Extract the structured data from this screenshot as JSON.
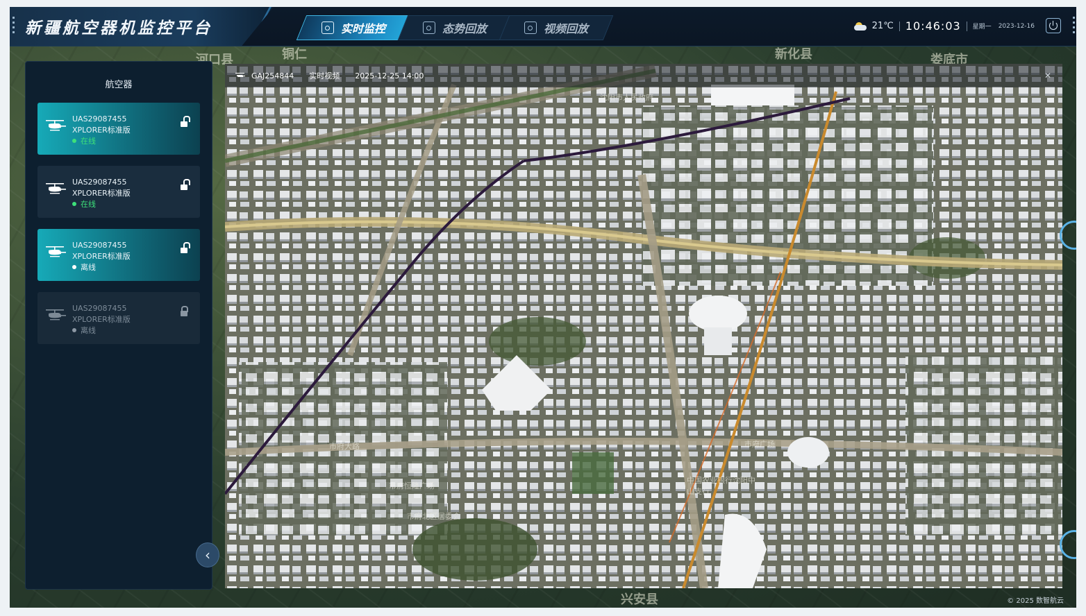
{
  "app": {
    "title": "新疆航空器机监控平台"
  },
  "tabs": [
    {
      "label": "实时监控",
      "active": true
    },
    {
      "label": "态势回放",
      "active": false
    },
    {
      "label": "视频回放",
      "active": false
    }
  ],
  "status": {
    "temperature": "21℃",
    "time": "10:46:03",
    "weekday": "星期一",
    "date": "2023-12-16",
    "weather_icon": "partly-cloudy-icon"
  },
  "panel": {
    "title": "航空器",
    "aircraft": [
      {
        "id": "UAS29087455",
        "model": "XPLORER标准版",
        "status": "在线",
        "status_color": "#3ee07a",
        "state": "online",
        "lock": "unlocked"
      },
      {
        "id": "UAS29087455",
        "model": "XPLORER标准版",
        "status": "在线",
        "status_color": "#3ee07a",
        "state": "normal",
        "lock": "unlocked"
      },
      {
        "id": "UAS29087455",
        "model": "XPLORER标准版",
        "status": "离线",
        "status_color": "#ffffff",
        "state": "online",
        "lock": "unlocked"
      },
      {
        "id": "UAS29087455",
        "model": "XPLORER标准版",
        "status": "离线",
        "status_color": "#8c98a4",
        "state": "disabled",
        "lock": "locked"
      }
    ]
  },
  "video": {
    "aircraft_id": "GAJ254844",
    "mode": "实时视频",
    "timestamp": "2025-12-25 14:00"
  },
  "map_labels": [
    "河口县",
    "铜仁",
    "新化县",
    "娄底市",
    "兴安县"
  ],
  "city_labels": [
    "市府大路",
    "市府广场",
    "中国农业银行沈阳中山支行",
    "市府北区居委会",
    "沈阳市人民政府",
    "市府恒隆广场"
  ],
  "footer": {
    "copyright": "© 2025 数智航云"
  },
  "colors": {
    "accent": "#23a5d8",
    "online": "#3ee07a",
    "panel_bg": "#0d1f2f"
  }
}
